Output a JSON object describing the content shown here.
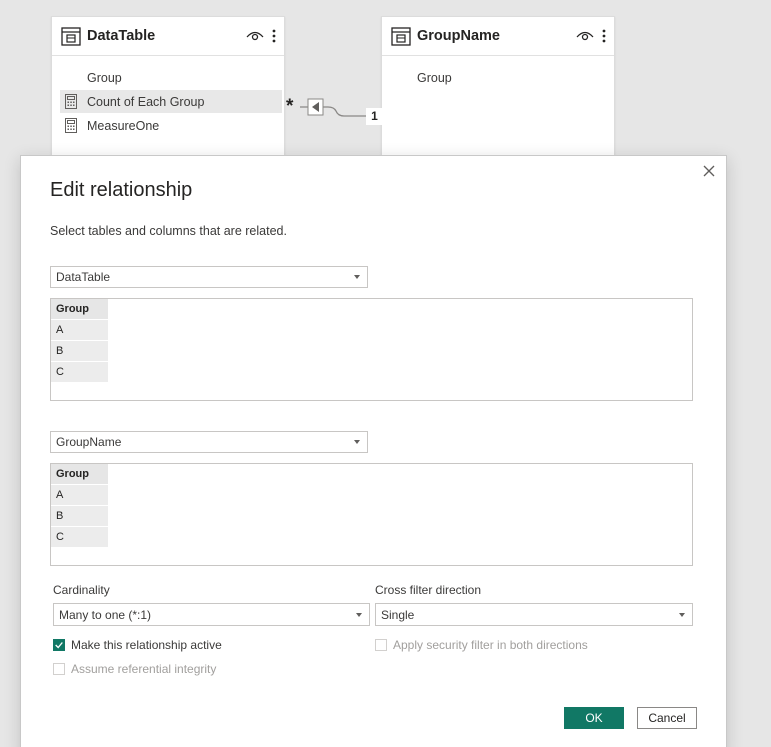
{
  "canvas": {
    "left_table": {
      "title": "DataTable",
      "fields": [
        {
          "label": "Group",
          "icon": "none"
        },
        {
          "label": "Count of Each Group",
          "icon": "calculator-icon"
        },
        {
          "label": "MeasureOne",
          "icon": "calculator-icon"
        }
      ]
    },
    "right_table": {
      "title": "GroupName",
      "fields": [
        {
          "label": "Group",
          "icon": "none"
        }
      ]
    },
    "relationship": {
      "many_marker": "*",
      "one_marker": "1"
    }
  },
  "dialog": {
    "title": "Edit relationship",
    "subtitle": "Select tables and columns that are related.",
    "table1": {
      "selected": "DataTable",
      "column_header": "Group",
      "rows": [
        "A",
        "B",
        "C"
      ]
    },
    "table2": {
      "selected": "GroupName",
      "column_header": "Group",
      "rows": [
        "A",
        "B",
        "C"
      ]
    },
    "cardinality": {
      "label": "Cardinality",
      "selected": "Many to one (*:1)"
    },
    "cross_filter": {
      "label": "Cross filter direction",
      "selected": "Single"
    },
    "checkboxes": {
      "active": {
        "label": "Make this relationship active",
        "checked": true,
        "enabled": true
      },
      "security": {
        "label": "Apply security filter in both directions",
        "checked": false,
        "enabled": false
      },
      "integrity": {
        "label": "Assume referential integrity",
        "checked": false,
        "enabled": false
      }
    },
    "buttons": {
      "ok": "OK",
      "cancel": "Cancel"
    }
  },
  "colors": {
    "accent": "#117865",
    "background": "#e6e6e6"
  }
}
